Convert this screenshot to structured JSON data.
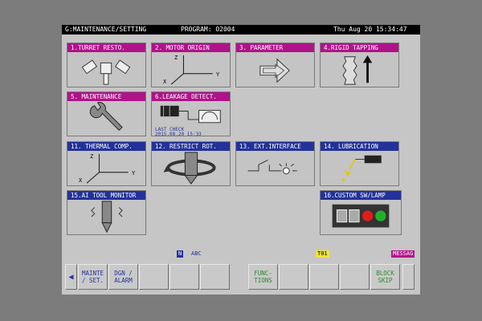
{
  "titlebar": {
    "mode": "G:MAINTENANCE/SETTING",
    "program": "PROGRAM: O2004",
    "datetime": "Thu Aug 20 15:34:47"
  },
  "tiles": [
    {
      "id": "turret",
      "label": "1.TURRET RESTO.",
      "color": "magenta"
    },
    {
      "id": "motor",
      "label": "2. MOTOR ORIGIN",
      "color": "magenta"
    },
    {
      "id": "param",
      "label": "3. PARAMETER",
      "color": "magenta"
    },
    {
      "id": "rigid",
      "label": "4.RIGID TAPPING",
      "color": "magenta"
    },
    {
      "id": "maint",
      "label": "5. MAINTENANCE",
      "color": "magenta"
    },
    {
      "id": "leak",
      "label": "6.LEAKAGE DETECT.",
      "color": "magenta"
    },
    {
      "id": "thermal",
      "label": "11. THERMAL COMP.",
      "color": "blue"
    },
    {
      "id": "restrict",
      "label": "12. RESTRICT ROT.",
      "color": "blue"
    },
    {
      "id": "extif",
      "label": "13. EXT.INTERFACE",
      "color": "blue"
    },
    {
      "id": "lube",
      "label": "14. LUBRICATION",
      "color": "blue"
    },
    {
      "id": "aitool",
      "label": "15.AI TOOL MONITOR",
      "color": "blue"
    },
    {
      "id": "custom",
      "label": "16.CUSTOM SW/LAMP",
      "color": "blue"
    }
  ],
  "leak_check": {
    "line1": "LAST CHECK",
    "line2": "2015.08.20 15:33"
  },
  "axes": {
    "z": "Z",
    "x": "X",
    "y": "Y"
  },
  "status": {
    "n": "N",
    "abc": "ABC",
    "t": "T01",
    "messag": "MESSAG"
  },
  "softkeys": [
    {
      "label": "MAINTE\n/ SET.",
      "color": "blue"
    },
    {
      "label": "DGN /\nALARM",
      "color": "blue"
    },
    {
      "label": "",
      "color": "blue"
    },
    {
      "label": "",
      "color": "blue"
    },
    {
      "label": "",
      "color": "blue"
    },
    {
      "label": "",
      "color": "blue"
    },
    {
      "label": "FUNC-\nTIONS",
      "color": "green"
    },
    {
      "label": "",
      "color": "green"
    },
    {
      "label": "",
      "color": "green"
    },
    {
      "label": "",
      "color": "green"
    },
    {
      "label": "BLOCK\nSKIP",
      "color": "green"
    }
  ],
  "colors": {
    "magenta": "#b0128a",
    "blue": "#23329a",
    "yellow": "#f1e33a",
    "green": "#2f8a2f"
  },
  "icons": {
    "prev": "left-triangle-icon"
  }
}
